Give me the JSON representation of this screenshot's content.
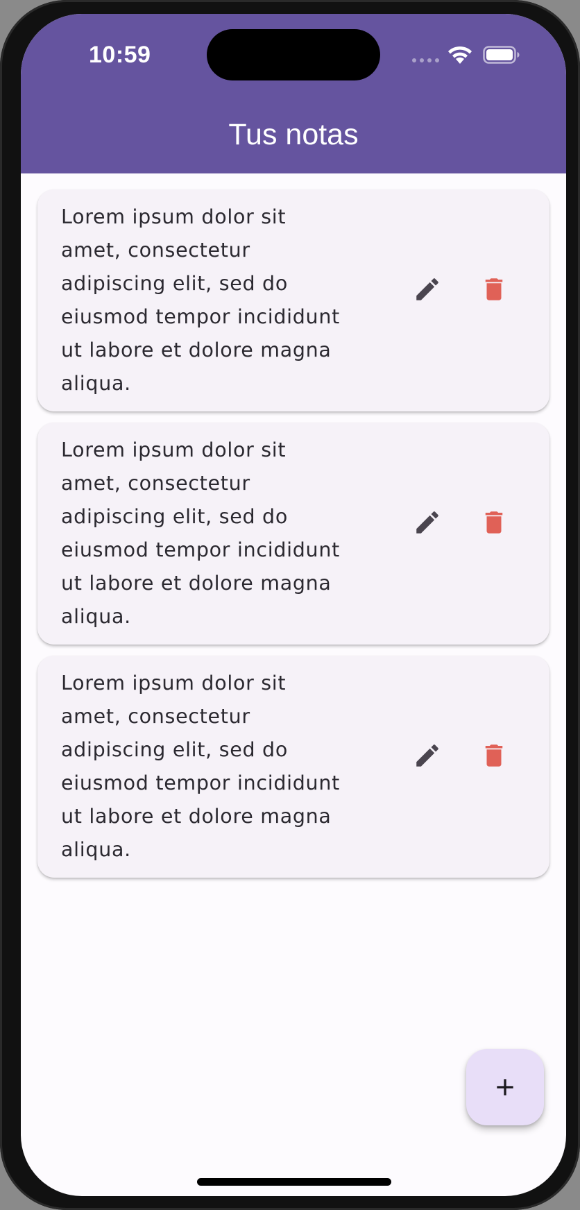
{
  "status_bar": {
    "time": "10:59"
  },
  "app_bar": {
    "title": "Tus notas"
  },
  "notes": [
    {
      "lines": [
        "Lorem ipsum dolor sit",
        "amet, consectetur",
        "adipiscing elit, sed do",
        "eiusmod tempor incididunt",
        "ut labore et dolore magna",
        "aliqua."
      ]
    },
    {
      "lines": [
        "Lorem ipsum dolor sit",
        "amet, consectetur",
        "adipiscing elit, sed do",
        "eiusmod tempor incididunt",
        "ut labore et dolore magna",
        "aliqua."
      ]
    },
    {
      "lines": [
        "Lorem ipsum dolor sit",
        "amet, consectetur",
        "adipiscing elit, sed do",
        "eiusmod tempor incididunt",
        "ut labore et dolore magna",
        "aliqua."
      ]
    }
  ],
  "icons": {
    "edit": "pencil-icon",
    "delete": "trash-icon",
    "add": "plus-icon",
    "wifi": "wifi-icon",
    "battery": "battery-icon",
    "signal": "signal-icon"
  },
  "colors": {
    "app_bar": "#65549f",
    "card_background": "#f6f2f8",
    "edit_icon": "#4a454f",
    "delete_icon": "#e06157",
    "fab_background": "#e8def8",
    "fab_icon": "#1d1b20"
  }
}
